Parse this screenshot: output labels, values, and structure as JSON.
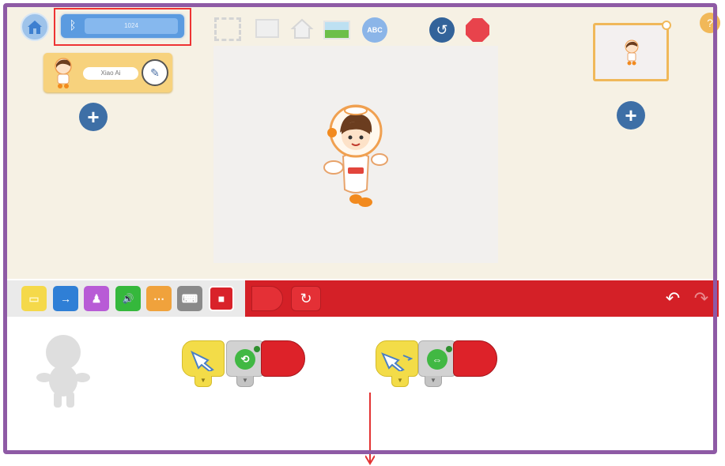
{
  "app": {
    "bluetooth_device_label": "1024",
    "bluetooth_icon_glyph": "ᛒ",
    "character_name": "Xiao Ai",
    "abc_button_label": "ABC",
    "add_symbol": "+",
    "reset_symbol": "↺",
    "help_symbol": "?"
  },
  "toolbar_icons": [
    "home-icon",
    "bluetooth-icon",
    "fullscreen-icon",
    "small-stage-icon",
    "home-scene-icon",
    "background-image-icon",
    "text-abc-icon",
    "reset-icon",
    "stop-icon",
    "help-icon"
  ],
  "categories": [
    {
      "name": "triggers",
      "color": "#f5d94a",
      "glyph": "▭"
    },
    {
      "name": "motion",
      "color": "#2f7fd6",
      "glyph": "→"
    },
    {
      "name": "looks",
      "color": "#b85bd6",
      "glyph": "♟"
    },
    {
      "name": "sound",
      "color": "#35b83c",
      "glyph": "🔊"
    },
    {
      "name": "control",
      "color": "#f0a23c",
      "glyph": "⋯"
    },
    {
      "name": "robot",
      "color": "#8a8a8a",
      "glyph": "⌨"
    },
    {
      "name": "end",
      "color": "#d9222a",
      "glyph": "■"
    }
  ],
  "end_tab": {
    "repeat_glyph": "↻"
  },
  "history": {
    "undo_glyph": "↶",
    "redo_glyph": "↷"
  },
  "script_blocks": [
    {
      "trigger": "tap-trigger",
      "action": "rotate",
      "action_glyph": "⟲",
      "dropdown_glyph": "▼"
    },
    {
      "trigger": "swipe-trigger",
      "action": "scale",
      "action_glyph": "⇔",
      "dropdown_glyph": "▼"
    }
  ],
  "colors": {
    "frame": "#8e5aa5",
    "stage_bg": "#f6f1e4",
    "red_bar": "#d42027",
    "highlight": "#e33333",
    "arrow": "#e33333"
  }
}
